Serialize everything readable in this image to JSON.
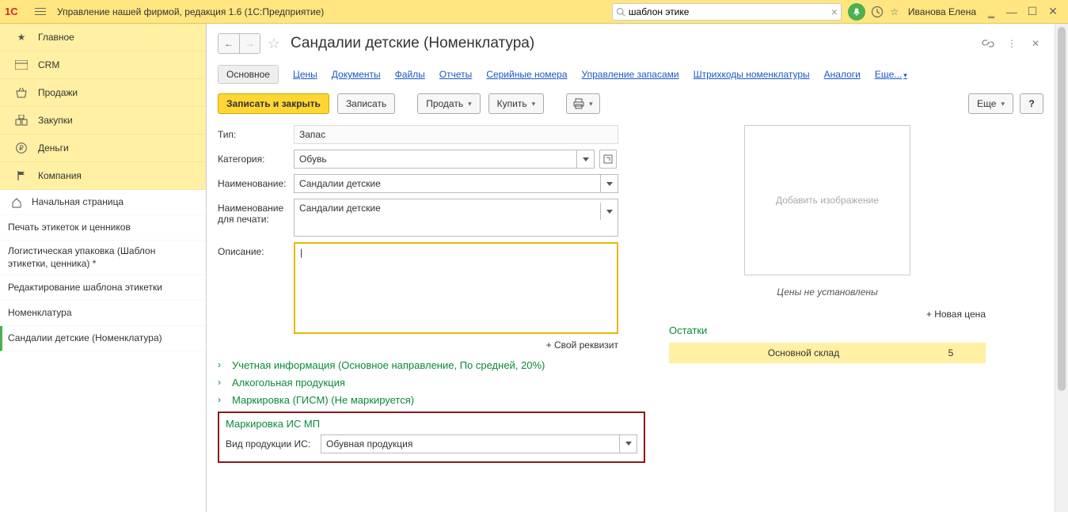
{
  "titlebar": {
    "app_title": "Управление нашей фирмой, редакция 1.6  (1С:Предприятие)",
    "search_value": "шаблон этике",
    "username": "Иванова Елена"
  },
  "sidebar": {
    "nav": [
      {
        "label": "Главное"
      },
      {
        "label": "CRM"
      },
      {
        "label": "Продажи"
      },
      {
        "label": "Закупки"
      },
      {
        "label": "Деньги"
      },
      {
        "label": "Компания"
      }
    ],
    "open": [
      {
        "label": "Начальная страница"
      },
      {
        "label": "Печать этикеток и ценников"
      },
      {
        "label": "Логистическая упаковка (Шаблон этикетки, ценника) *"
      },
      {
        "label": "Редактирование шаблона этикетки"
      },
      {
        "label": "Номенклатура"
      },
      {
        "label": "Сандалии детские (Номенклатура)"
      }
    ]
  },
  "page": {
    "title": "Сандалии детские (Номенклатура)",
    "tabs": [
      "Основное",
      "Цены",
      "Документы",
      "Файлы",
      "Отчеты",
      "Серийные номера",
      "Управление запасами",
      "Штрихкоды номенклатуры",
      "Аналоги",
      "Еще..."
    ],
    "toolbar": {
      "save_close": "Записать и закрыть",
      "save": "Записать",
      "sell": "Продать",
      "buy": "Купить",
      "more": "Еще"
    },
    "form": {
      "type_label": "Тип:",
      "type_value": "Запас",
      "category_label": "Категория:",
      "category_value": "Обувь",
      "name_label": "Наименование:",
      "name_value": "Сандалии детские",
      "printname_label": "Наименование для печати:",
      "printname_value": "Сандалии детские",
      "desc_label": "Описание:",
      "own_prop": "Свой реквизит"
    },
    "collapsibles": {
      "accounting": "Учетная информация (Основное направление, По средней, 20%)",
      "alcohol": "Алкогольная продукция",
      "gism": "Маркировка (ГИСМ) (Не маркируется)"
    },
    "marking": {
      "title": "Маркировка ИС МП",
      "kind_label": "Вид продукции ИС:",
      "kind_value": "Обувная продукция"
    },
    "right": {
      "add_image": "Добавить изображение",
      "prices_note": "Цены не установлены",
      "new_price": "Новая цена",
      "stock_title": "Остатки",
      "stock_name": "Основной склад",
      "stock_qty": "5"
    }
  }
}
